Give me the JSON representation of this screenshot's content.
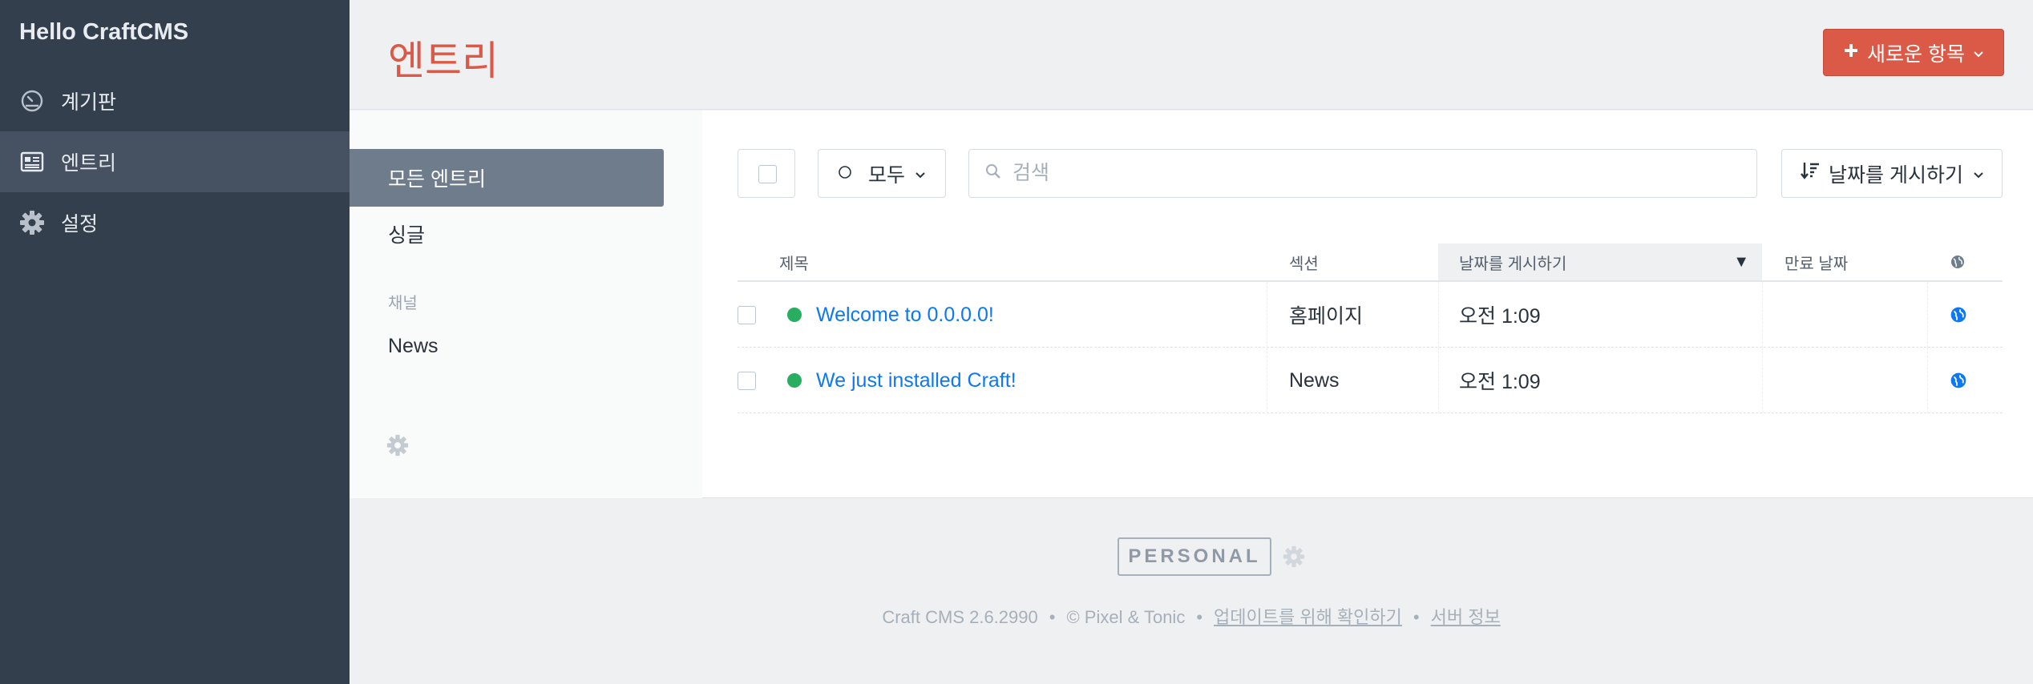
{
  "site": {
    "name": "Hello CraftCMS"
  },
  "nav": [
    {
      "label": "계기판",
      "icon": "dashboard-icon"
    },
    {
      "label": "엔트리",
      "icon": "newspaper-icon"
    },
    {
      "label": "설정",
      "icon": "gear-icon"
    }
  ],
  "header": {
    "title": "엔트리",
    "new_button": "새로운 항목"
  },
  "sources": {
    "all": "모든 엔트리",
    "singles": "싱글",
    "heading_channel": "채널",
    "news": "News"
  },
  "toolbar": {
    "status_label": "모두",
    "search_placeholder": "검색",
    "sort_label": "날짜를 게시하기"
  },
  "table": {
    "columns": {
      "title": "제목",
      "section": "섹션",
      "post_date": "날짜를 게시하기",
      "expiry": "만료 날짜"
    },
    "sort_indicator": "▼",
    "rows": [
      {
        "title": "Welcome to 0.0.0.0!",
        "section": "홈페이지",
        "post_date": "오전 1:09",
        "expiry": "",
        "status": "live"
      },
      {
        "title": "We just installed Craft!",
        "section": "News",
        "post_date": "오전 1:09",
        "expiry": "",
        "status": "live"
      }
    ]
  },
  "footer": {
    "edition": "PERSONAL",
    "version": "Craft CMS 2.6.2990",
    "copyright": "© Pixel & Tonic",
    "check_updates": "업데이트를 위해 확인하기",
    "server_info": "서버 정보",
    "separator": "•"
  },
  "colors": {
    "accent_red": "#da5a47",
    "sidebar_bg": "#333f4d",
    "link_blue": "#0d78f2",
    "status_live": "#27ae60"
  }
}
